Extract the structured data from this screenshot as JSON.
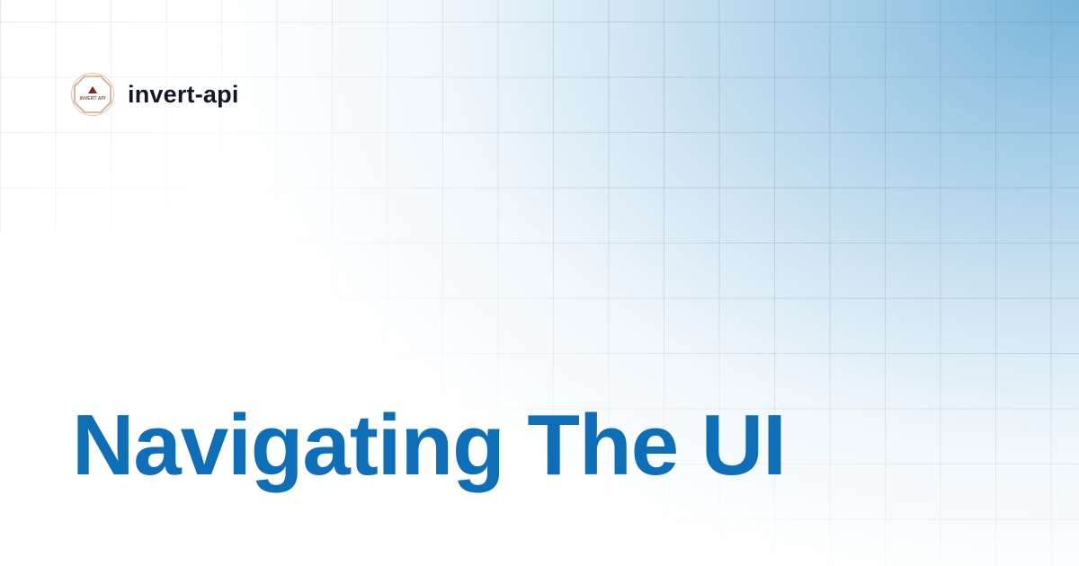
{
  "brand": {
    "name": "invert-api",
    "logo_text": "INVERT API",
    "logo_icon": "triangle-octagon-logo-icon"
  },
  "main": {
    "title": "Navigating The UI"
  },
  "colors": {
    "title": "#0e6fb8",
    "brand_text": "#111827",
    "logo_outline": "#d9a689",
    "logo_triangle": "#7a2a22",
    "accent_gradient": "#7cb6da"
  }
}
